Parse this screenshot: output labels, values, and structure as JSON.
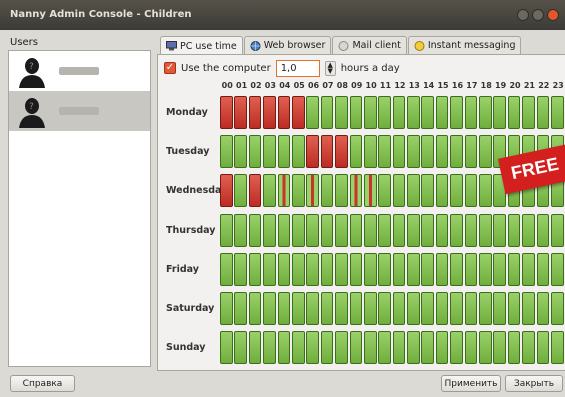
{
  "window": {
    "title": "Nanny Admin Console - Children"
  },
  "users": {
    "label": "Users",
    "items": [
      {
        "name": "",
        "selected": false
      },
      {
        "name": "",
        "selected": true
      }
    ]
  },
  "tabs": [
    {
      "label": "PC use time",
      "icon": "computer-icon",
      "active": true
    },
    {
      "label": "Web browser",
      "icon": "globe-icon",
      "active": false
    },
    {
      "label": "Mail client",
      "icon": "mail-icon",
      "active": false
    },
    {
      "label": "Instant messaging",
      "icon": "smiley-icon",
      "active": false
    }
  ],
  "use_computer": {
    "checked": true,
    "label_before": "Use the computer",
    "value": "1,0",
    "label_after": "hours a day"
  },
  "hours": [
    "00",
    "01",
    "02",
    "03",
    "04",
    "05",
    "06",
    "07",
    "08",
    "09",
    "10",
    "11",
    "12",
    "13",
    "14",
    "15",
    "16",
    "17",
    "18",
    "19",
    "20",
    "21",
    "22",
    "23"
  ],
  "days": [
    {
      "label": "Monday",
      "blocked": [
        0,
        1,
        2,
        3,
        4,
        5
      ],
      "partial": []
    },
    {
      "label": "Tuesday",
      "blocked": [
        6,
        7,
        8
      ],
      "partial": []
    },
    {
      "label": "Wednesday",
      "blocked": [
        0,
        2
      ],
      "partial": [
        4,
        6,
        9,
        10
      ]
    },
    {
      "label": "Thursday",
      "blocked": [],
      "partial": []
    },
    {
      "label": "Friday",
      "blocked": [],
      "partial": []
    },
    {
      "label": "Saturday",
      "blocked": [],
      "partial": []
    },
    {
      "label": "Sunday",
      "blocked": [],
      "partial": []
    }
  ],
  "badge": "FREE",
  "buttons": {
    "help": "Справка",
    "apply": "Применить",
    "close": "Закрыть"
  },
  "colors": {
    "allowed": "#7cbf47",
    "blocked": "#c8342a",
    "badge": "#d41f1f"
  }
}
